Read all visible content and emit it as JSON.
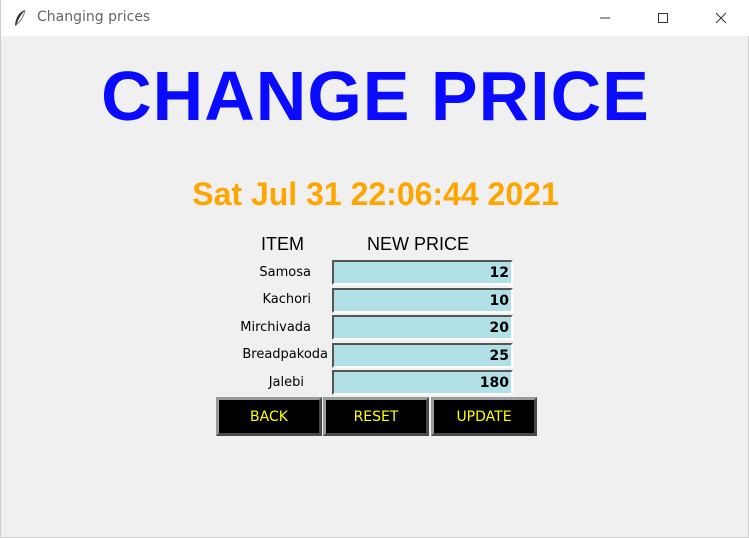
{
  "window": {
    "title": "Changing prices"
  },
  "heading": "CHANGE PRICE",
  "datetime": "Sat Jul 31 22:06:44 2021",
  "table": {
    "col_item": "ITEM",
    "col_price": "NEW PRICE",
    "rows": [
      {
        "item": "Samosa",
        "price": "12"
      },
      {
        "item": "Kachori",
        "price": "10"
      },
      {
        "item": "Mirchivada",
        "price": "20"
      },
      {
        "item": "Breadpakoda",
        "price": "25"
      },
      {
        "item": "Jalebi",
        "price": "180"
      }
    ]
  },
  "buttons": {
    "back": "BACK",
    "reset": "RESET",
    "update": "UPDATE"
  },
  "colors": {
    "heading": "#0a0aff",
    "datetime": "#ffa500",
    "input_bg": "#b0e0e6",
    "button_bg": "#000000",
    "button_text": "#ffff00"
  },
  "icons": {
    "app": "feather-icon",
    "minimize": "minimize-icon",
    "maximize": "maximize-icon",
    "close": "close-icon"
  }
}
